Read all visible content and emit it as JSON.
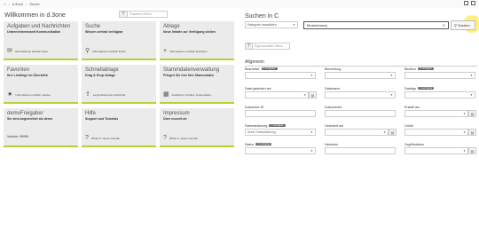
{
  "topbar": {
    "home_icon": "home-icon",
    "crumbs": [
      "d.3one",
      "Suche"
    ],
    "window_icons": [
      "restore-icon",
      "new-window-icon"
    ]
  },
  "left": {
    "title": "Willkommen in d.3one",
    "quickfilter_placeholder": "Platzieren filtern",
    "tiles": [
      {
        "title": "Aufgaben und Nachrichten",
        "sub": "Unternehmensweit Kommunikation",
        "foot": "Informationen abrufen lesen",
        "icon": "envelope-icon"
      },
      {
        "title": "Suche",
        "sub": "Wissen zentral verfügbar",
        "foot": "Informationen einfach finden",
        "icon": "search-icon"
      },
      {
        "title": "Ablage",
        "sub": "Neue Inhalte zur Verfügung stellen",
        "foot": "Informationen einfach speichern",
        "icon": "plus-icon"
      },
      {
        "title": "Favoriten",
        "sub": "Ihre Lieblinge im Überblick",
        "foot": "Informationen einfach merken",
        "icon": "star-icon"
      },
      {
        "title": "Schnellablage",
        "sub": "Drag & Drop Ablage",
        "foot": "Legt Dokumente schnell ab",
        "icon": "upload-icon"
      },
      {
        "title": "Stammdatenverwaltung",
        "sub": "Pflegen Sie hier Ihre Stammdaten",
        "foot": "Kreditoren, Kunden, Kostenstelle...",
        "icon": "table-icon"
      },
      {
        "title": "demoFreigaber",
        "sub": "Sie sind angemeldet als demo",
        "version": "Version: 99999",
        "icon": ""
      },
      {
        "title": "Hilfe",
        "sub": "Support und Tutorials",
        "foot": "Öffnet in neuem Fenster",
        "icon": "question-icon"
      },
      {
        "title": "Impressum",
        "sub": "Über ecoceil.de",
        "foot": "Öffnet in neuem Fenster",
        "icon": "question-icon"
      }
    ]
  },
  "right": {
    "title": "Suchen in C",
    "category_select": "Kategorie auswählen",
    "search_value": "Mustermann|",
    "search_button": "Suchen",
    "filter_placeholder": "Eigenschaften filtern",
    "section": "Allgemein",
    "fields": [
      {
        "label": "Bearbeiter",
        "badge": "2 verfügbar",
        "value": "",
        "type": "select"
      },
      {
        "label": "Bemerkung",
        "badge": "",
        "value": "",
        "type": "select"
      },
      {
        "label": "Besitzer",
        "badge": "2 verfügbar",
        "value": "",
        "type": "select"
      },
      {
        "label": "Datei geändert am",
        "badge": "",
        "value": "",
        "type": "date"
      },
      {
        "label": "Dateiname",
        "badge": "",
        "value": "",
        "type": "select"
      },
      {
        "label": "Dateityp",
        "badge": "2 verfügbar",
        "value": "",
        "type": "select"
      },
      {
        "label": "Dokument-ID",
        "badge": "",
        "value": "",
        "type": "text"
      },
      {
        "label": "Dokumentnr.",
        "badge": "",
        "value": "",
        "type": "text"
      },
      {
        "label": "Erstellt am",
        "badge": "",
        "value": "",
        "type": "date"
      },
      {
        "label": "Farbmarkierung",
        "badge": "7 verfügbar",
        "value": "Keine Farbmarkierung",
        "type": "select"
      },
      {
        "label": "Geändert am",
        "badge": "",
        "value": "",
        "type": "date"
      },
      {
        "label": "Größe",
        "badge": "",
        "value": "",
        "type": "date"
      },
      {
        "label": "Status",
        "badge": "3 verfügbar",
        "value": "",
        "type": "select"
      },
      {
        "label": "Varianten",
        "badge": "",
        "value": "",
        "type": "text"
      },
      {
        "label": "Zugriffsdatum",
        "badge": "",
        "value": "",
        "type": "date"
      }
    ]
  }
}
